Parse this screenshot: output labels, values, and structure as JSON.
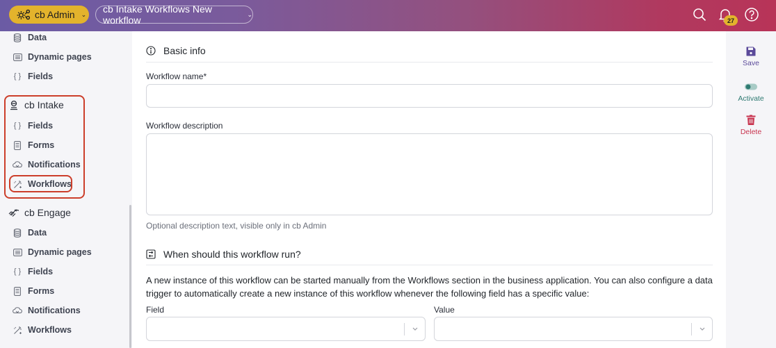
{
  "header": {
    "app_switcher_label": "cb Admin",
    "breadcrumb_label": "cb Intake Workflows New workflow",
    "notifications_count": "27",
    "icons": [
      "search-icon",
      "bell-icon",
      "help-icon"
    ]
  },
  "sidebar": {
    "top_items": [
      {
        "label": "Data",
        "icon": "database-icon"
      },
      {
        "label": "Dynamic pages",
        "icon": "list-icon"
      },
      {
        "label": "Fields",
        "icon": "braces-icon"
      }
    ],
    "groups": [
      {
        "label": "cb Intake",
        "icon": "intake-icon",
        "items": [
          {
            "label": "Fields",
            "icon": "braces-icon"
          },
          {
            "label": "Forms",
            "icon": "form-icon"
          },
          {
            "label": "Notifications",
            "icon": "notification-icon"
          },
          {
            "label": "Workflows",
            "icon": "wand-icon",
            "selected": true
          }
        ]
      },
      {
        "label": "cb Engage",
        "icon": "handshake-icon",
        "items": [
          {
            "label": "Data",
            "icon": "database-icon"
          },
          {
            "label": "Dynamic pages",
            "icon": "list-icon"
          },
          {
            "label": "Fields",
            "icon": "braces-icon"
          },
          {
            "label": "Forms",
            "icon": "form-icon"
          },
          {
            "label": "Notifications",
            "icon": "notification-icon"
          },
          {
            "label": "Workflows",
            "icon": "wand-icon"
          }
        ]
      }
    ]
  },
  "main": {
    "basic_info": {
      "title": "Basic info",
      "name_label": "Workflow name",
      "required_mark": "*",
      "name_value": "",
      "description_label": "Workflow description",
      "description_value": "",
      "description_help": "Optional description text, visible only in cb Admin"
    },
    "trigger": {
      "title": "When should this workflow run?",
      "paragraph": "A new instance of this workflow can be started manually from the Workflows section in the business application. You can also configure a data trigger to automatically create a new instance of this workflow whenever the following field has a specific value:",
      "field_label": "Field",
      "field_value": "",
      "value_label": "Value",
      "value_value": ""
    }
  },
  "actions": {
    "save_label": "Save",
    "activate_label": "Activate",
    "delete_label": "Delete",
    "colors": {
      "save": "#5b4a9a",
      "activate": "#2f7a72",
      "delete": "#c8344f"
    }
  }
}
